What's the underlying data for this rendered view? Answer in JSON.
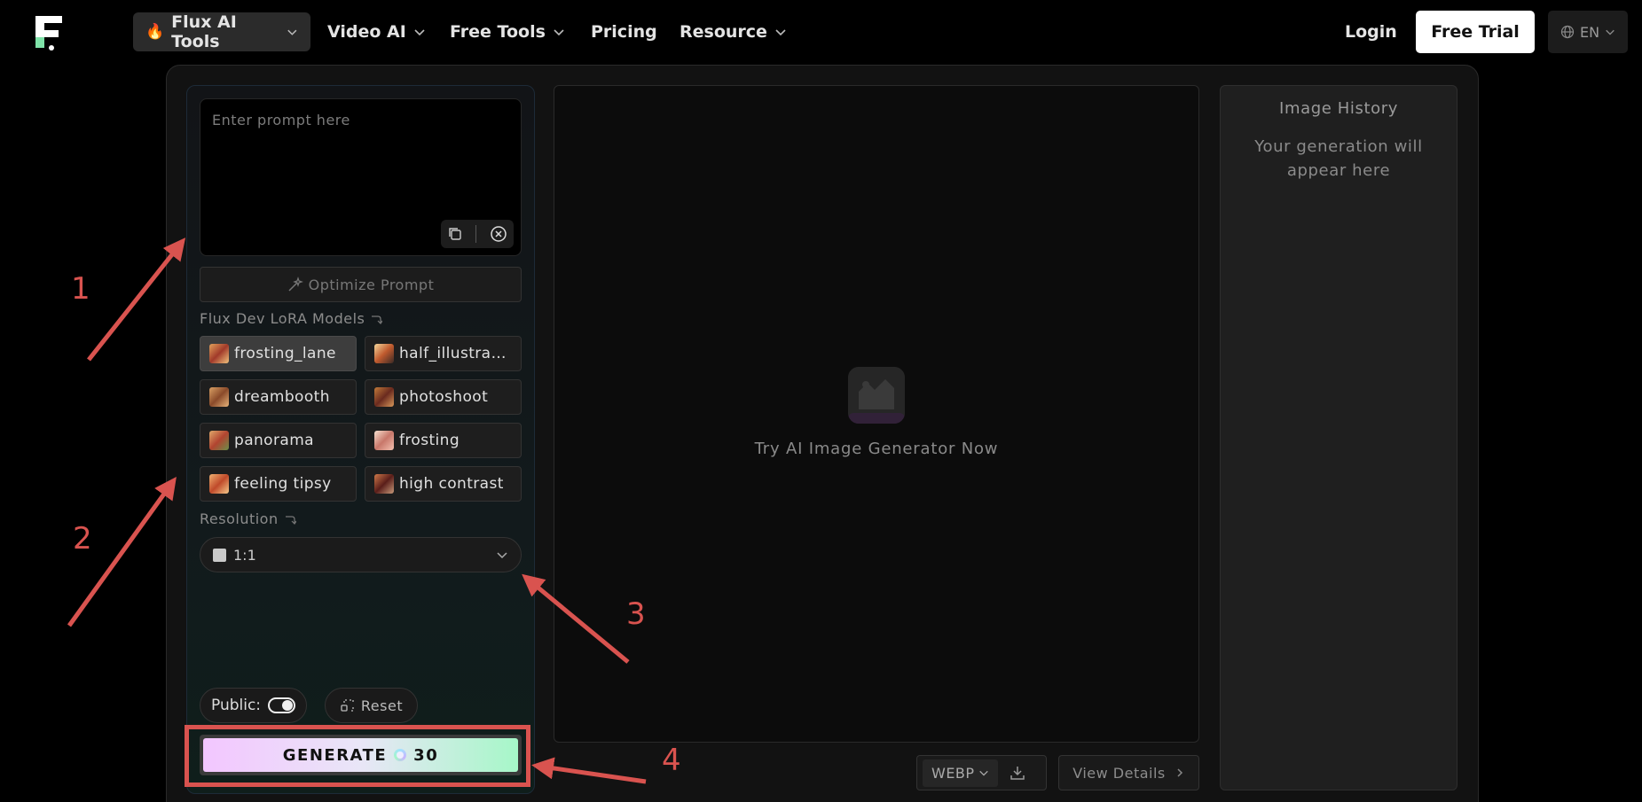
{
  "nav": {
    "items": [
      {
        "label": "Flux AI Tools",
        "active": true
      },
      {
        "label": "Video AI"
      },
      {
        "label": "Free Tools"
      },
      {
        "label": "Pricing"
      },
      {
        "label": "Resource"
      }
    ],
    "login": "Login",
    "free_trial": "Free Trial",
    "lang": "EN"
  },
  "prompt": {
    "placeholder": "Enter prompt here",
    "optimize_label": "Optimize Prompt"
  },
  "models": {
    "section_label": "Flux Dev LoRA Models",
    "items": [
      {
        "label": "frosting_lane",
        "selected": true
      },
      {
        "label": "half_illustrat..."
      },
      {
        "label": "dreambooth"
      },
      {
        "label": "photoshoot"
      },
      {
        "label": "panorama"
      },
      {
        "label": "frosting"
      },
      {
        "label": "feeling tipsy"
      },
      {
        "label": "high contrast"
      }
    ]
  },
  "resolution": {
    "section_label": "Resolution",
    "value": "1:1"
  },
  "controls": {
    "public_label": "Public:",
    "public_enabled": true,
    "reset_label": "Reset",
    "generate_label": "GENERATE",
    "generate_cost": "30"
  },
  "canvas": {
    "hint": "Try AI Image Generator Now",
    "format": "WEBP",
    "view_details": "View Details"
  },
  "history": {
    "title": "Image History",
    "empty": "Your generation will appear here"
  },
  "annotations": [
    "1",
    "2",
    "3",
    "4"
  ],
  "colors": {
    "accent_annotation": "#d9534f",
    "generate_gradient_start": "#f3c6ff",
    "generate_gradient_end": "#a6f7c8"
  }
}
